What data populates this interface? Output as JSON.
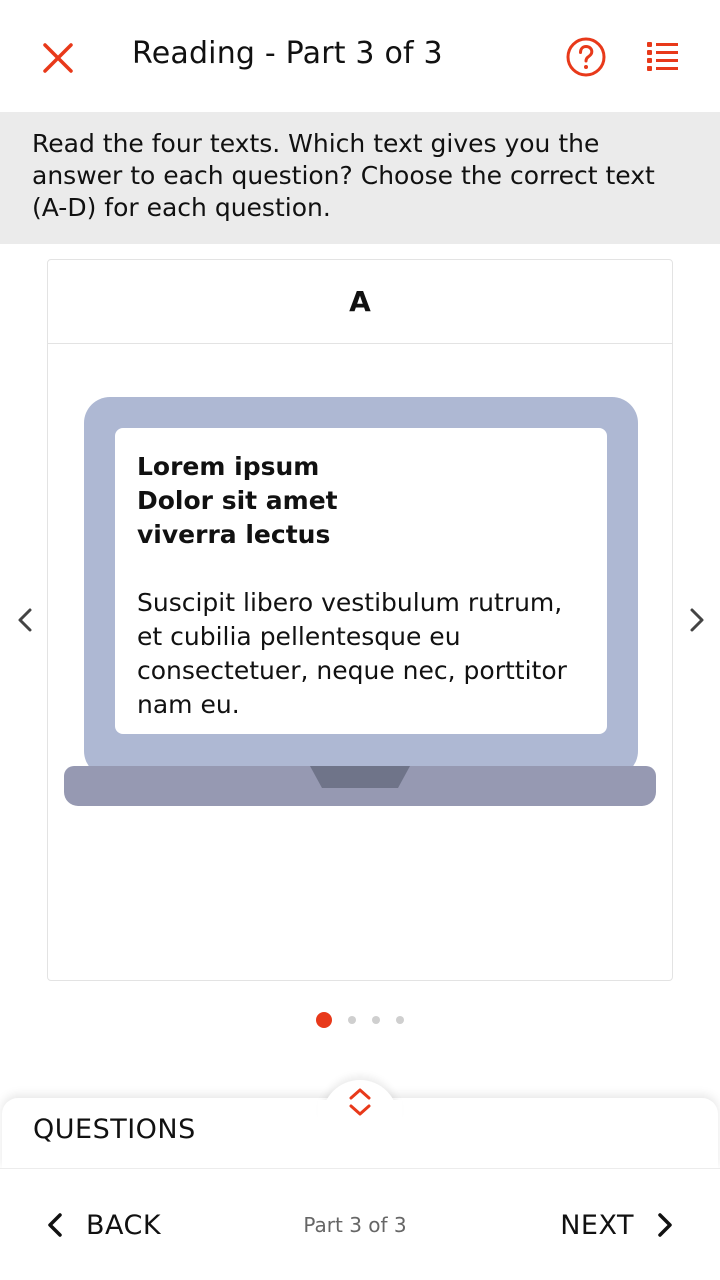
{
  "header": {
    "title": "Reading - Part 3 of 3",
    "close_icon": "close-icon",
    "help_icon": "help-circle-icon",
    "list_icon": "list-icon",
    "accent_color": "#e8391a"
  },
  "instructions": {
    "text": "Read the four texts. Which text gives you the answer to each question? Choose the correct text (A-D) for each question."
  },
  "card": {
    "letter": "A",
    "heading_lines": [
      "Lorem ipsum",
      "Dolor sit amet",
      "viverra lectus"
    ],
    "body": "Suscipit libero vestibulum rutrum, et cubilia pellentesque eu consectetuer, neque nec, porttitor nam eu."
  },
  "pager": {
    "total": 4,
    "active_index": 0
  },
  "questions": {
    "label": "QUESTIONS"
  },
  "footer": {
    "back_label": "BACK",
    "status": "Part 3 of 3",
    "next_label": "NEXT"
  }
}
